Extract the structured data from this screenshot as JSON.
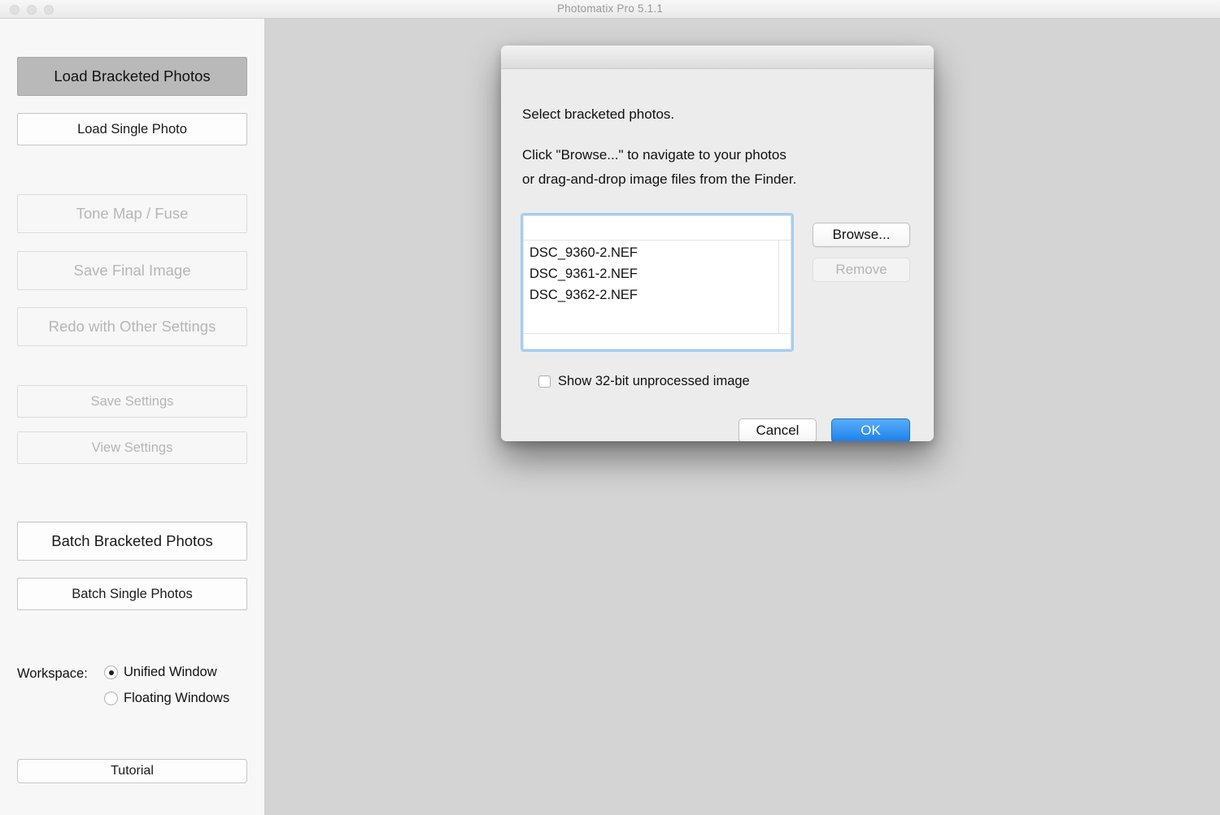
{
  "window": {
    "title": "Photomatix Pro 5.1.1",
    "traffic_lights": [
      "close",
      "minimize",
      "zoom"
    ]
  },
  "colors": {
    "accent_blue": "#3d9af3",
    "focus_ring": "#a5cdf2",
    "sidebar_bg": "#f7f7f7",
    "canvas_bg": "#d4d4d4",
    "dialog_bg": "#ececec",
    "disabled_text": "#b6b6b6"
  },
  "sidebar": {
    "buttons": [
      {
        "id": "load-bracketed",
        "label": "Load Bracketed Photos",
        "state": "active"
      },
      {
        "id": "load-single",
        "label": "Load Single Photo",
        "state": "enabled"
      },
      {
        "id": "tonemap-fuse",
        "label": "Tone Map / Fuse",
        "state": "disabled"
      },
      {
        "id": "save-final-image",
        "label": "Save Final Image",
        "state": "disabled"
      },
      {
        "id": "redo-other-settings",
        "label": "Redo with Other Settings",
        "state": "disabled"
      },
      {
        "id": "save-settings",
        "label": "Save Settings",
        "state": "disabled"
      },
      {
        "id": "view-settings",
        "label": "View Settings",
        "state": "disabled"
      },
      {
        "id": "batch-bracketed",
        "label": "Batch Bracketed Photos",
        "state": "enabled"
      },
      {
        "id": "batch-single",
        "label": "Batch Single Photos",
        "state": "enabled"
      },
      {
        "id": "tutorial",
        "label": "Tutorial",
        "state": "enabled"
      }
    ],
    "workspace": {
      "label": "Workspace:",
      "options": [
        {
          "label": "Unified Window",
          "selected": true
        },
        {
          "label": "Floating Windows",
          "selected": false
        }
      ]
    }
  },
  "dialog": {
    "heading": "Select bracketed photos.",
    "instruction_line_1": "Click \"Browse...\" to navigate to your photos",
    "instruction_line_2": "or drag-and-drop image files from the Finder.",
    "file_list": {
      "items": [
        "DSC_9360-2.NEF",
        "DSC_9361-2.NEF",
        "DSC_9362-2.NEF"
      ],
      "focused": true
    },
    "browse_label": "Browse...",
    "remove_label": "Remove",
    "remove_enabled": false,
    "checkbox": {
      "label": "Show 32-bit unprocessed image",
      "checked": false
    },
    "cancel_label": "Cancel",
    "ok_label": "OK"
  }
}
